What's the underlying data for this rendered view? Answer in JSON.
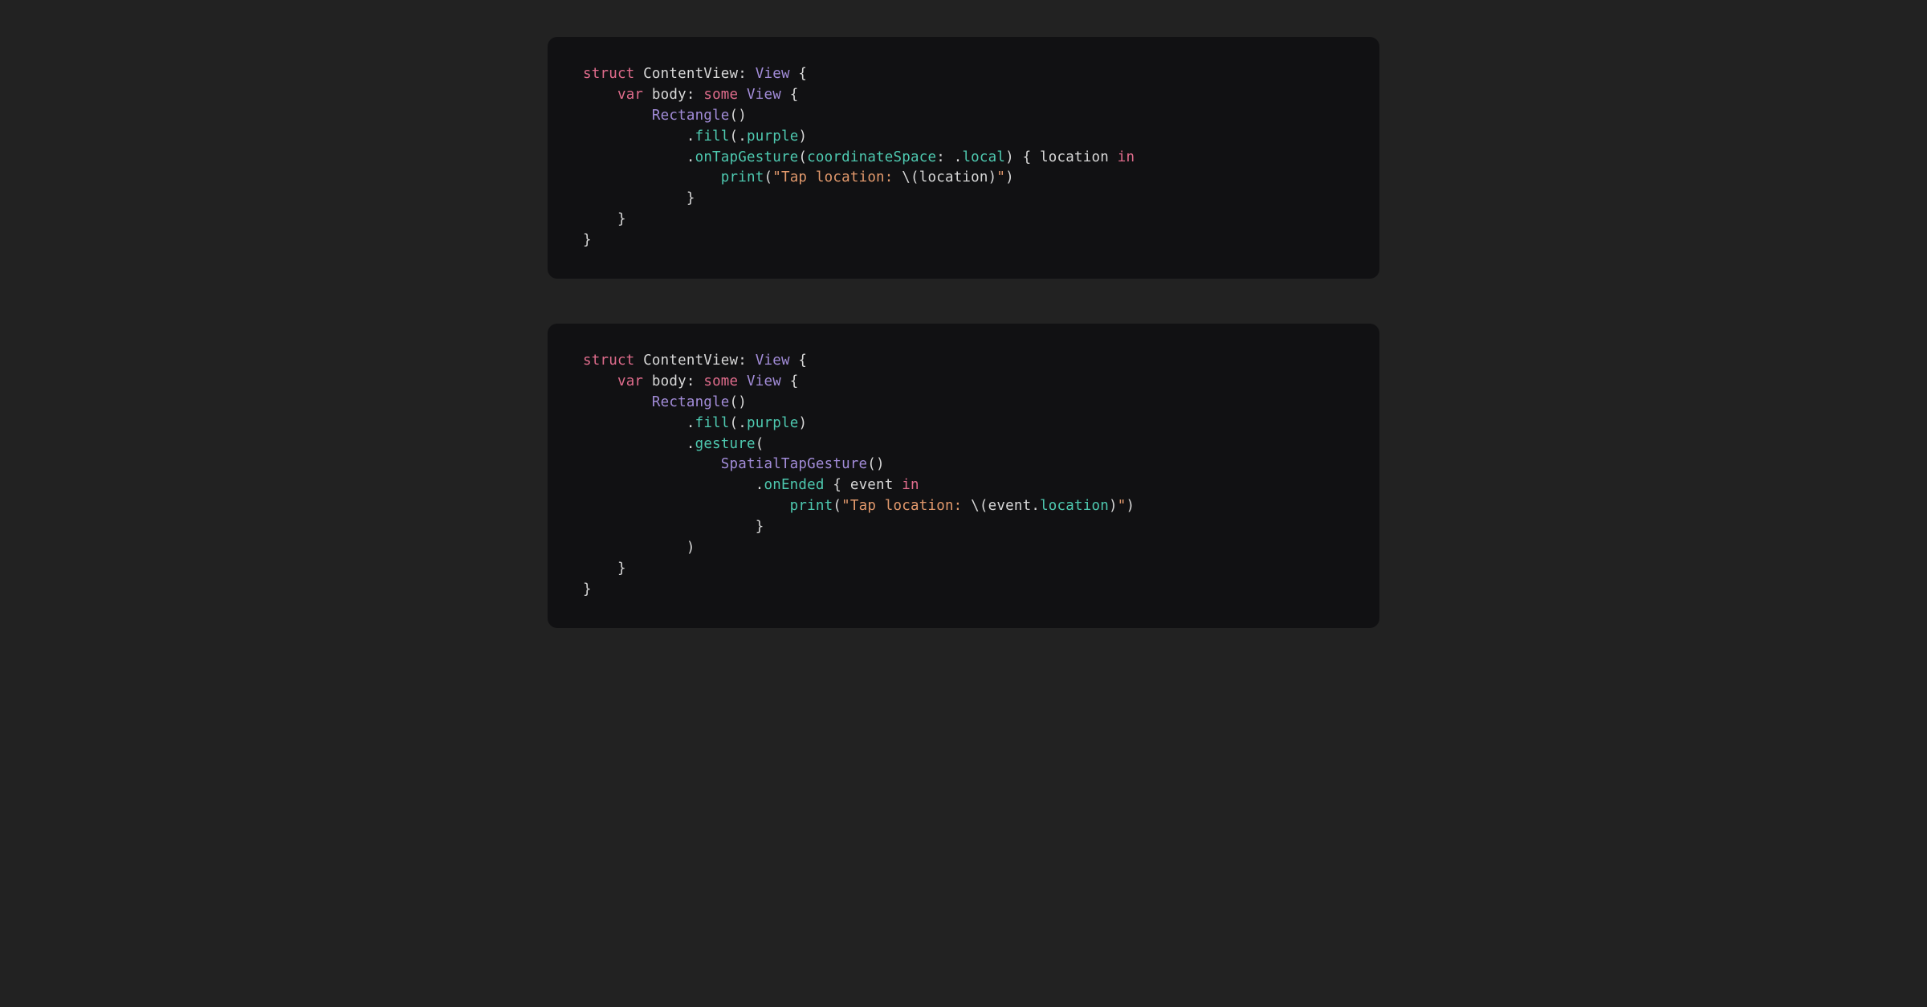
{
  "colors": {
    "page_bg": "#222222",
    "block_bg": "#111113",
    "text": "#d8d8d8",
    "keyword": "#e06c8c",
    "type_func": "#a28cd8",
    "method_enum": "#4ec9b0",
    "string": "#e2996c"
  },
  "block1": {
    "l1": {
      "a": "struct",
      "b": " ContentView: ",
      "c": "View",
      "d": " {"
    },
    "l2": {
      "a": "    ",
      "b": "var",
      "c": " body: ",
      "d": "some",
      "e": " ",
      "f": "View",
      "g": " {"
    },
    "l3": {
      "a": "        ",
      "b": "Rectangle",
      "c": "()"
    },
    "l4": {
      "a": "            .",
      "b": "fill",
      "c": "(.",
      "d": "purple",
      "e": ")"
    },
    "l5": {
      "a": "            .",
      "b": "onTapGesture",
      "c": "(",
      "d": "coordinateSpace",
      "e": ": .",
      "f": "local",
      "g": ") { location ",
      "h": "in"
    },
    "l6": {
      "a": "                ",
      "b": "print",
      "c": "(",
      "d": "\"Tap location: ",
      "e": "\\(",
      "f": "location",
      "g": ")",
      "h": "\"",
      "i": ")"
    },
    "l7": {
      "a": "            }"
    },
    "l8": {
      "a": "    }"
    },
    "l9": {
      "a": "}"
    }
  },
  "block2": {
    "l1": {
      "a": "struct",
      "b": " ContentView: ",
      "c": "View",
      "d": " {"
    },
    "l2": {
      "a": "    ",
      "b": "var",
      "c": " body: ",
      "d": "some",
      "e": " ",
      "f": "View",
      "g": " {"
    },
    "l3": {
      "a": "        ",
      "b": "Rectangle",
      "c": "()"
    },
    "l4": {
      "a": "            .",
      "b": "fill",
      "c": "(.",
      "d": "purple",
      "e": ")"
    },
    "l5": {
      "a": "            .",
      "b": "gesture",
      "c": "("
    },
    "l6": {
      "a": "                ",
      "b": "SpatialTapGesture",
      "c": "()"
    },
    "l7": {
      "a": "                    .",
      "b": "onEnded",
      "c": " { event ",
      "d": "in"
    },
    "l8": {
      "a": "                        ",
      "b": "print",
      "c": "(",
      "d": "\"Tap location: ",
      "e": "\\(",
      "f": "event.",
      "g": "location",
      "h": ")",
      "i": "\"",
      "j": ")"
    },
    "l9": {
      "a": "                    }"
    },
    "l10": {
      "a": "            )"
    },
    "l11": {
      "a": "    }"
    },
    "l12": {
      "a": "}"
    }
  }
}
